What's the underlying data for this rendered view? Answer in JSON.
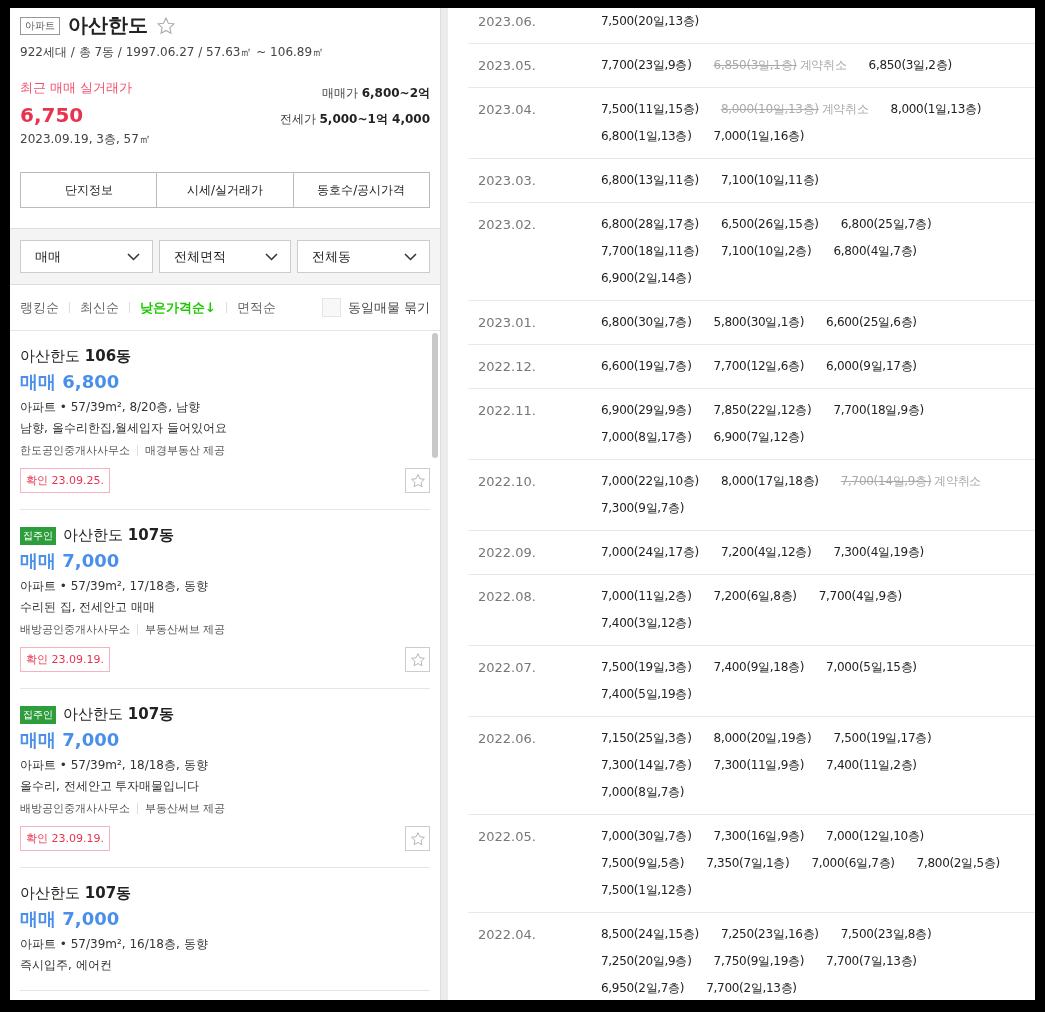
{
  "complex": {
    "type_badge": "아파트",
    "name": "아산한도",
    "favorite": false,
    "info": "922세대 / 총 7동 / 1997.06.27 / 57.63㎡ ~ 106.89㎡",
    "recent_label": "최근 매매 실거래가",
    "recent_price": "6,750",
    "recent_detail": "2023.09.19, 3층, 57㎡",
    "sale_range": "매매가 **6,800~2억**",
    "jeonse_range": "전세가 **5,000~1억 4,000**"
  },
  "tabs": [
    {
      "label": "단지정보",
      "selected": false
    },
    {
      "label": "시세/실거래가",
      "selected": false
    },
    {
      "label": "동호수/공시가격",
      "selected": false
    }
  ],
  "filters": [
    "매매",
    "전체면적",
    "전체동"
  ],
  "sorts": [
    {
      "label": "랭킹순",
      "selected": false
    },
    {
      "label": "최신순",
      "selected": false
    },
    {
      "label": "낮은가격순↓",
      "selected": true
    },
    {
      "label": "면적순",
      "selected": false
    }
  ],
  "group_same": {
    "label": "동일매물 묶기",
    "checked": false
  },
  "listings": [
    {
      "title": "아산한도 **106동**",
      "price": "매매 6,800",
      "spec": "아파트 • 57/39m², 8/20층, 남향",
      "desc": "남향, 올수리한집,월세입자 들어있어요",
      "agency": "한도공인중개사사무소",
      "provider": "매경부동산 제공",
      "confirmed": "확인 23.09.25.",
      "favorite": false
    },
    {
      "owner_tag": "집주인",
      "title": "아산한도 **107동**",
      "price": "매매 7,000",
      "spec": "아파트 • 57/39m², 17/18층, 동향",
      "desc": "수리된 집, 전세안고 매매",
      "agency": "배방공인중개사사무소",
      "provider": "부동산써브 제공",
      "confirmed": "확인 23.09.19.",
      "favorite": false
    },
    {
      "owner_tag": "집주인",
      "title": "아산한도 **107동**",
      "price": "매매 7,000",
      "spec": "아파트 • 57/39m², 18/18층, 동향",
      "desc": "올수리, 전세안고 투자매물입니다",
      "agency": "배방공인중개사사무소",
      "provider": "부동산써브 제공",
      "confirmed": "확인 23.09.19.",
      "favorite": false
    },
    {
      "title": "아산한도 **107동**",
      "price": "매매 7,000",
      "spec": "아파트 • 57/39m², 16/18층, 동향",
      "desc": "즉시입주, 에어컨"
    }
  ],
  "transactions": [
    {
      "month": "2023.06.",
      "deals": [
        {
          "text": "7,500(20일,13층)",
          "cancelled": false
        }
      ]
    },
    {
      "month": "2023.05.",
      "deals": [
        {
          "text": "7,700(23일,9층)",
          "cancelled": false
        },
        {
          "text": "6,850(3일,1층)",
          "cancelled": true,
          "note": "계약취소"
        },
        {
          "text": "6,850(3일,2층)",
          "cancelled": false
        }
      ]
    },
    {
      "month": "2023.04.",
      "deals": [
        {
          "text": "7,500(11일,15층)",
          "cancelled": false
        },
        {
          "text": "8,000(10일,13층)",
          "cancelled": true,
          "note": "계약취소"
        },
        {
          "text": "8,000(1일,13층)",
          "cancelled": false
        },
        {
          "text": "6,800(1일,13층)",
          "cancelled": false
        },
        {
          "text": "7,000(1일,16층)",
          "cancelled": false
        }
      ]
    },
    {
      "month": "2023.03.",
      "deals": [
        {
          "text": "6,800(13일,11층)",
          "cancelled": false
        },
        {
          "text": "7,100(10일,11층)",
          "cancelled": false
        }
      ]
    },
    {
      "month": "2023.02.",
      "deals": [
        {
          "text": "6,800(28일,17층)",
          "cancelled": false
        },
        {
          "text": "6,500(26일,15층)",
          "cancelled": false
        },
        {
          "text": "6,800(25일,7층)",
          "cancelled": false
        },
        {
          "text": "7,700(18일,11층)",
          "cancelled": false
        },
        {
          "text": "7,100(10일,2층)",
          "cancelled": false
        },
        {
          "text": "6,800(4일,7층)",
          "cancelled": false
        },
        {
          "text": "6,900(2일,14층)",
          "cancelled": false
        }
      ]
    },
    {
      "month": "2023.01.",
      "deals": [
        {
          "text": "6,800(30일,7층)",
          "cancelled": false
        },
        {
          "text": "5,800(30일,1층)",
          "cancelled": false
        },
        {
          "text": "6,600(25일,6층)",
          "cancelled": false
        }
      ]
    },
    {
      "month": "2022.12.",
      "deals": [
        {
          "text": "6,600(19일,7층)",
          "cancelled": false
        },
        {
          "text": "7,700(12일,6층)",
          "cancelled": false
        },
        {
          "text": "6,000(9일,17층)",
          "cancelled": false
        }
      ]
    },
    {
      "month": "2022.11.",
      "deals": [
        {
          "text": "6,900(29일,9층)",
          "cancelled": false
        },
        {
          "text": "7,850(22일,12층)",
          "cancelled": false
        },
        {
          "text": "7,700(18일,9층)",
          "cancelled": false
        },
        {
          "text": "7,000(8일,17층)",
          "cancelled": false
        },
        {
          "text": "6,900(7일,12층)",
          "cancelled": false
        }
      ]
    },
    {
      "month": "2022.10.",
      "deals": [
        {
          "text": "7,000(22일,10층)",
          "cancelled": false
        },
        {
          "text": "8,000(17일,18층)",
          "cancelled": false
        },
        {
          "text": "7,700(14일,9층)",
          "cancelled": true,
          "note": "계약취소"
        },
        {
          "text": "7,300(9일,7층)",
          "cancelled": false
        }
      ]
    },
    {
      "month": "2022.09.",
      "deals": [
        {
          "text": "7,000(24일,17층)",
          "cancelled": false
        },
        {
          "text": "7,200(4일,12층)",
          "cancelled": false
        },
        {
          "text": "7,300(4일,19층)",
          "cancelled": false
        }
      ]
    },
    {
      "month": "2022.08.",
      "deals": [
        {
          "text": "7,000(11일,2층)",
          "cancelled": false
        },
        {
          "text": "7,200(6일,8층)",
          "cancelled": false
        },
        {
          "text": "7,700(4일,9층)",
          "cancelled": false
        },
        {
          "text": "7,400(3일,12층)",
          "cancelled": false
        }
      ]
    },
    {
      "month": "2022.07.",
      "deals": [
        {
          "text": "7,500(19일,3층)",
          "cancelled": false
        },
        {
          "text": "7,400(9일,18층)",
          "cancelled": false
        },
        {
          "text": "7,000(5일,15층)",
          "cancelled": false
        },
        {
          "text": "7,400(5일,19층)",
          "cancelled": false
        }
      ]
    },
    {
      "month": "2022.06.",
      "deals": [
        {
          "text": "7,150(25일,3층)",
          "cancelled": false
        },
        {
          "text": "8,000(20일,19층)",
          "cancelled": false
        },
        {
          "text": "7,500(19일,17층)",
          "cancelled": false
        },
        {
          "text": "7,300(14일,7층)",
          "cancelled": false
        },
        {
          "text": "7,300(11일,9층)",
          "cancelled": false
        },
        {
          "text": "7,400(11일,2층)",
          "cancelled": false
        },
        {
          "text": "7,000(8일,7층)",
          "cancelled": false
        }
      ]
    },
    {
      "month": "2022.05.",
      "deals": [
        {
          "text": "7,000(30일,7층)",
          "cancelled": false
        },
        {
          "text": "7,300(16일,9층)",
          "cancelled": false
        },
        {
          "text": "7,000(12일,10층)",
          "cancelled": false
        },
        {
          "text": "7,500(9일,5층)",
          "cancelled": false
        },
        {
          "text": "7,350(7일,1층)",
          "cancelled": false
        },
        {
          "text": "7,000(6일,7층)",
          "cancelled": false
        },
        {
          "text": "7,800(2일,5층)",
          "cancelled": false
        },
        {
          "text": "7,500(1일,12층)",
          "cancelled": false
        }
      ]
    },
    {
      "month": "2022.04.",
      "deals": [
        {
          "text": "8,500(24일,15층)",
          "cancelled": false
        },
        {
          "text": "7,250(23일,16층)",
          "cancelled": false
        },
        {
          "text": "7,500(23일,8층)",
          "cancelled": false
        },
        {
          "text": "7,250(20일,9층)",
          "cancelled": false
        },
        {
          "text": "7,750(9일,19층)",
          "cancelled": false
        },
        {
          "text": "7,700(7일,13층)",
          "cancelled": false
        },
        {
          "text": "6,950(2일,7층)",
          "cancelled": false
        },
        {
          "text": "7,700(2일,13층)",
          "cancelled": false
        }
      ]
    }
  ]
}
